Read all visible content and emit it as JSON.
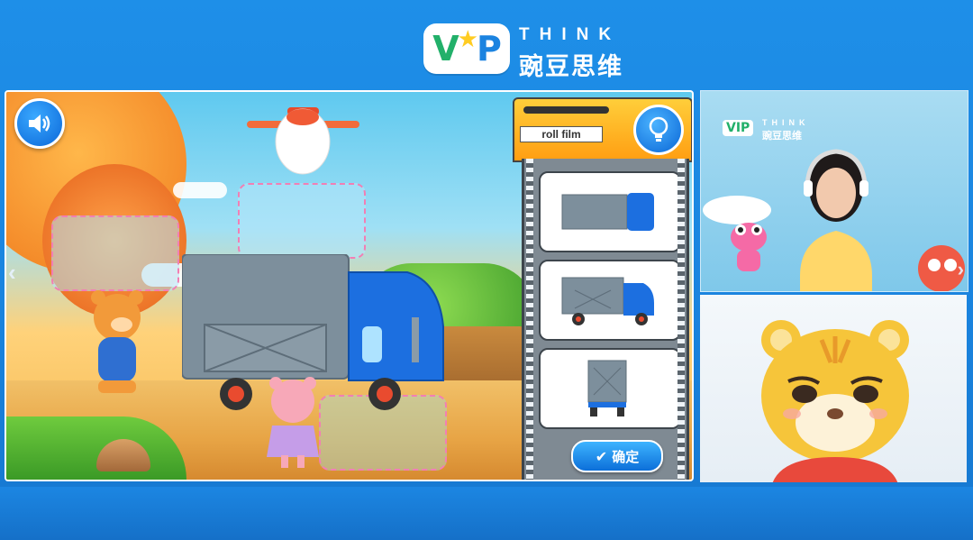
{
  "header": {
    "logo_badge": "VIP",
    "logo_think": "THINK",
    "logo_cn": "豌豆思维"
  },
  "game": {
    "sound_button": "speaker-icon",
    "film_label": "roll film",
    "hint_button": "lightbulb-icon",
    "confirm_label": "确定",
    "options": [
      "truck-top-view",
      "truck-side-view",
      "truck-back-view"
    ]
  },
  "teacher_panel": {
    "logo_badge": "VIP",
    "logo_think": "THINK",
    "logo_cn": "豌豆思维"
  },
  "colors": {
    "background": "#1a84df",
    "accent": "#0c6fd9",
    "drop_zone_border": "#f27fb4",
    "film_header": "#ffb020"
  }
}
